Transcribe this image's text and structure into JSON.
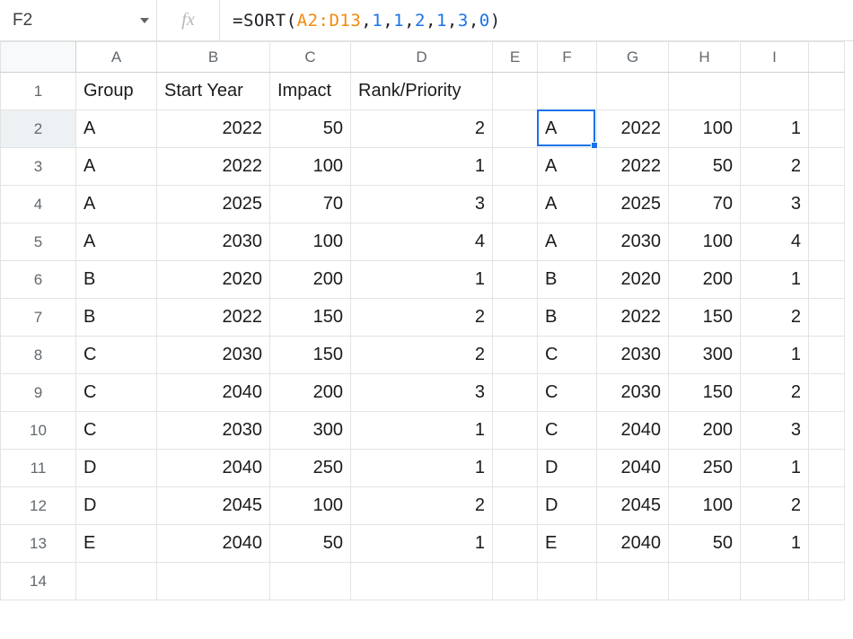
{
  "name_box": {
    "value": "F2"
  },
  "fx_label": "fx",
  "formula": {
    "prefix": "=SORT(",
    "range": "A2:D13",
    "sep1": ",",
    "n1": "1",
    "sep2": ",",
    "n2": "1",
    "sep3": ",",
    "n3": "2",
    "sep4": ",",
    "n4": "1",
    "sep5": ",",
    "n5": "3",
    "sep6": ",",
    "n6": "0",
    "suffix": ")"
  },
  "columns": [
    "A",
    "B",
    "C",
    "D",
    "E",
    "F",
    "G",
    "H",
    "I"
  ],
  "row_numbers": [
    "1",
    "2",
    "3",
    "4",
    "5",
    "6",
    "7",
    "8",
    "9",
    "10",
    "11",
    "12",
    "13",
    "14"
  ],
  "active_cell": "F2",
  "headers": {
    "A": "Group",
    "B": "Start Year",
    "C": "Impact",
    "D": "Rank/Priority"
  },
  "left_rows": [
    {
      "A": "A",
      "B": "2022",
      "C": "50",
      "D": "2"
    },
    {
      "A": "A",
      "B": "2022",
      "C": "100",
      "D": "1"
    },
    {
      "A": "A",
      "B": "2025",
      "C": "70",
      "D": "3"
    },
    {
      "A": "A",
      "B": "2030",
      "C": "100",
      "D": "4"
    },
    {
      "A": "B",
      "B": "2020",
      "C": "200",
      "D": "1"
    },
    {
      "A": "B",
      "B": "2022",
      "C": "150",
      "D": "2"
    },
    {
      "A": "C",
      "B": "2030",
      "C": "150",
      "D": "2"
    },
    {
      "A": "C",
      "B": "2040",
      "C": "200",
      "D": "3"
    },
    {
      "A": "C",
      "B": "2030",
      "C": "300",
      "D": "1"
    },
    {
      "A": "D",
      "B": "2040",
      "C": "250",
      "D": "1"
    },
    {
      "A": "D",
      "B": "2045",
      "C": "100",
      "D": "2"
    },
    {
      "A": "E",
      "B": "2040",
      "C": "50",
      "D": "1"
    }
  ],
  "right_rows": [
    {
      "F": "A",
      "G": "2022",
      "H": "100",
      "I": "1"
    },
    {
      "F": "A",
      "G": "2022",
      "H": "50",
      "I": "2"
    },
    {
      "F": "A",
      "G": "2025",
      "H": "70",
      "I": "3"
    },
    {
      "F": "A",
      "G": "2030",
      "H": "100",
      "I": "4"
    },
    {
      "F": "B",
      "G": "2020",
      "H": "200",
      "I": "1"
    },
    {
      "F": "B",
      "G": "2022",
      "H": "150",
      "I": "2"
    },
    {
      "F": "C",
      "G": "2030",
      "H": "300",
      "I": "1"
    },
    {
      "F": "C",
      "G": "2030",
      "H": "150",
      "I": "2"
    },
    {
      "F": "C",
      "G": "2040",
      "H": "200",
      "I": "3"
    },
    {
      "F": "D",
      "G": "2040",
      "H": "250",
      "I": "1"
    },
    {
      "F": "D",
      "G": "2045",
      "H": "100",
      "I": "2"
    },
    {
      "F": "E",
      "G": "2040",
      "H": "50",
      "I": "1"
    }
  ]
}
